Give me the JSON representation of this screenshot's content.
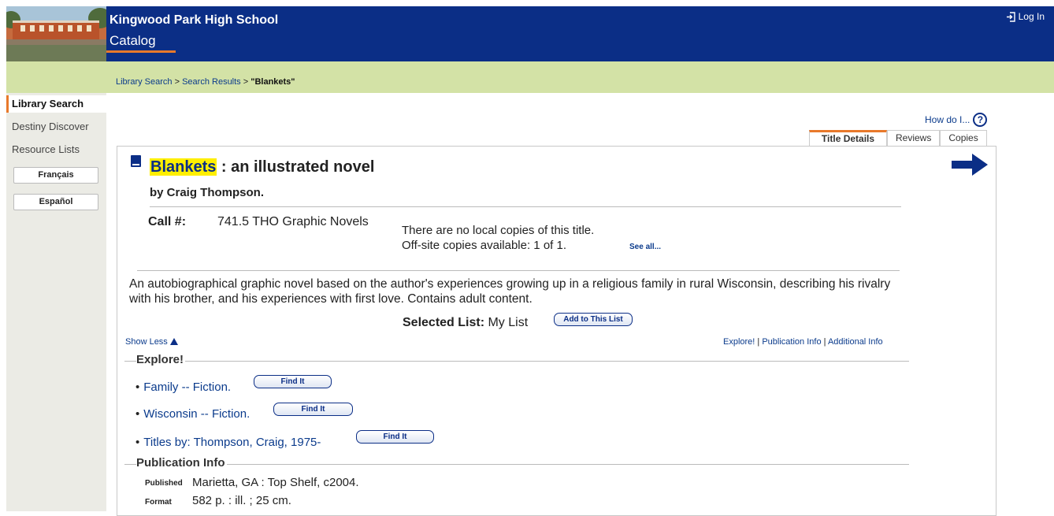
{
  "header": {
    "school_name": "Kingwood Park High School",
    "catalog_label": "Catalog",
    "login_label": "Log In"
  },
  "breadcrumb": {
    "library_search": "Library Search",
    "separator1": " > ",
    "search_results": "Search Results",
    "separator2": " > ",
    "current": "\"Blankets\""
  },
  "sidebar": {
    "items": [
      {
        "label": "Library Search",
        "active": true
      },
      {
        "label": "Destiny Discover"
      },
      {
        "label": "Resource Lists"
      }
    ],
    "languages": [
      "Français",
      "Español"
    ]
  },
  "help": {
    "label": "How do I...",
    "icon_glyph": "?"
  },
  "tabs": [
    {
      "label": "Title Details",
      "active": true
    },
    {
      "label": "Reviews"
    },
    {
      "label": "Copies"
    }
  ],
  "record": {
    "title_highlight": "Blankets",
    "title_rest": " : an illustrated novel",
    "author": "by Craig Thompson.",
    "call_label": "Call #:",
    "call_number": "741.5 THO Graphic Novels",
    "copies_line1": "There are no local copies of this title.",
    "copies_line2": "Off-site copies available: 1 of 1.",
    "see_all": "See all...",
    "summary": "An autobiographical graphic novel based on the author's experiences growing up in a religious family in rural Wisconsin, describing his rivalry with his brother, and his experiences with first love. Contains adult content.",
    "selected_list_label": "Selected List:",
    "selected_list_value": " My List",
    "add_to_list": "Add to This List",
    "show_less": "Show Less",
    "jump_links": [
      "Explore!",
      "Publication Info",
      "Additional Info"
    ],
    "jump_sep": " | "
  },
  "explore": {
    "heading": "Explore!",
    "find_it_label": "Find It",
    "items": [
      "Family -- Fiction.",
      "Wisconsin -- Fiction.",
      "Titles by: Thompson, Craig, 1975-"
    ]
  },
  "publication": {
    "heading": "Publication Info",
    "rows": [
      {
        "label": "Published",
        "value": "Marietta, GA : Top Shelf, c2004."
      },
      {
        "label": "Format",
        "value": "582 p. : ill. ; 25 cm."
      }
    ]
  },
  "colors": {
    "header_bg": "#0b2e86",
    "crumb_bg": "#d3e2a6",
    "accent": "#e8792b",
    "highlight": "#ffef00",
    "link": "#0b3b8c"
  }
}
